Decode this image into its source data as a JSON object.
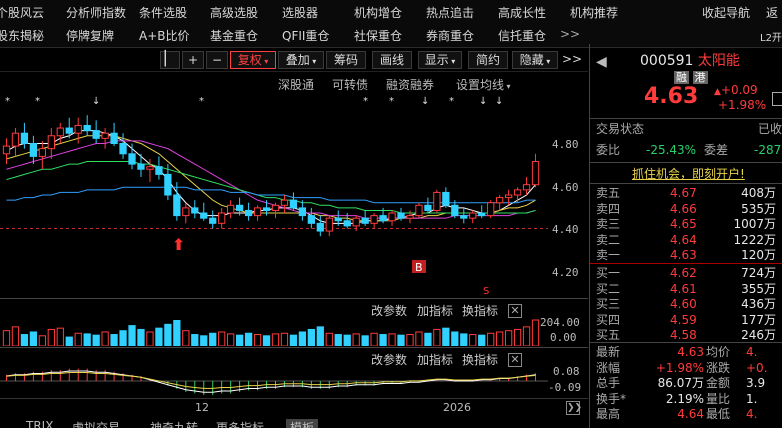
{
  "nav": {
    "row1": [
      "个股风云",
      "分析师指数",
      "条件选股",
      "高级选股",
      "选股器",
      "机构增仓",
      "热点追击",
      "高成长性",
      "机构推荐",
      "收起导航",
      "返"
    ],
    "row2": [
      "股东揭秘",
      "停牌复牌",
      "A+B比价",
      "基金重仓",
      "QFII重仓",
      "社保重仓",
      "券商重仓",
      "信托重仓",
      ">>"
    ],
    "right_tag": "L2开"
  },
  "toolbar": {
    "buttons": [
      "+",
      "−",
      "复权",
      "叠加",
      "筹码",
      "画线",
      "显示",
      "简约",
      "隐藏"
    ],
    "active": "复权",
    "more": ">>"
  },
  "chart_header": {
    "items": [
      "深股通",
      "可转债",
      "融资融券",
      "设置均线"
    ]
  },
  "price_axis": [
    "4.80",
    "4.60",
    "4.40",
    "4.20"
  ],
  "volume_panel": {
    "labels": [
      "改参数",
      "加指标",
      "换指标"
    ],
    "axis": [
      "204.00",
      "0.00"
    ]
  },
  "macd_panel": {
    "labels": [
      "改参数",
      "加指标",
      "换指标"
    ],
    "axis": [
      "0.08",
      "-0.09"
    ]
  },
  "x_axis": [
    "12",
    "2026"
  ],
  "markers": {
    "buy_label": "B",
    "sell_label": "S"
  },
  "bottom_tabs": [
    "TRIX",
    "虚拟交易",
    "神奇九转",
    "更多指标",
    "模板"
  ],
  "chart_data": {
    "type": "candlestick",
    "ylim": [
      4.1,
      4.9
    ],
    "reference_line": 4.37,
    "candles": [
      [
        4.66,
        4.72,
        4.62,
        4.69
      ],
      [
        4.69,
        4.76,
        4.65,
        4.74
      ],
      [
        4.74,
        4.78,
        4.68,
        4.7
      ],
      [
        4.7,
        4.73,
        4.62,
        4.65
      ],
      [
        4.65,
        4.71,
        4.6,
        4.68
      ],
      [
        4.68,
        4.76,
        4.64,
        4.73
      ],
      [
        4.73,
        4.78,
        4.7,
        4.76
      ],
      [
        4.76,
        4.8,
        4.72,
        4.74
      ],
      [
        4.74,
        4.8,
        4.7,
        4.77
      ],
      [
        4.77,
        4.81,
        4.73,
        4.75
      ],
      [
        4.75,
        4.79,
        4.7,
        4.72
      ],
      [
        4.72,
        4.76,
        4.68,
        4.74
      ],
      [
        4.74,
        4.78,
        4.69,
        4.7
      ],
      [
        4.7,
        4.74,
        4.64,
        4.66
      ],
      [
        4.66,
        4.7,
        4.6,
        4.62
      ],
      [
        4.62,
        4.66,
        4.57,
        4.6
      ],
      [
        4.6,
        4.64,
        4.55,
        4.61
      ],
      [
        4.61,
        4.65,
        4.56,
        4.58
      ],
      [
        4.58,
        4.62,
        4.48,
        4.5
      ],
      [
        4.5,
        4.55,
        4.4,
        4.42
      ],
      [
        4.42,
        4.47,
        4.39,
        4.45
      ],
      [
        4.45,
        4.48,
        4.41,
        4.43
      ],
      [
        4.43,
        4.47,
        4.4,
        4.41
      ],
      [
        4.41,
        4.44,
        4.37,
        4.39
      ],
      [
        4.39,
        4.45,
        4.37,
        4.43
      ],
      [
        4.43,
        4.48,
        4.41,
        4.46
      ],
      [
        4.46,
        4.49,
        4.42,
        4.44
      ],
      [
        4.44,
        4.47,
        4.4,
        4.42
      ],
      [
        4.42,
        4.46,
        4.4,
        4.45
      ],
      [
        4.45,
        4.48,
        4.42,
        4.44
      ],
      [
        4.44,
        4.47,
        4.41,
        4.46
      ],
      [
        4.46,
        4.5,
        4.43,
        4.48
      ],
      [
        4.48,
        4.51,
        4.44,
        4.45
      ],
      [
        4.45,
        4.48,
        4.4,
        4.42
      ],
      [
        4.42,
        4.45,
        4.37,
        4.39
      ],
      [
        4.39,
        4.42,
        4.34,
        4.36
      ],
      [
        4.36,
        4.42,
        4.34,
        4.41
      ],
      [
        4.41,
        4.44,
        4.38,
        4.4
      ],
      [
        4.4,
        4.43,
        4.37,
        4.38
      ],
      [
        4.38,
        4.42,
        4.36,
        4.41
      ],
      [
        4.41,
        4.44,
        4.38,
        4.39
      ],
      [
        4.39,
        4.43,
        4.37,
        4.42
      ],
      [
        4.42,
        4.45,
        4.39,
        4.4
      ],
      [
        4.4,
        4.44,
        4.38,
        4.43
      ],
      [
        4.43,
        4.45,
        4.4,
        4.41
      ],
      [
        4.41,
        4.44,
        4.39,
        4.42
      ],
      [
        4.42,
        4.47,
        4.41,
        4.46
      ],
      [
        4.46,
        4.49,
        4.43,
        4.44
      ],
      [
        4.44,
        4.52,
        4.43,
        4.51
      ],
      [
        4.51,
        4.53,
        4.45,
        4.46
      ],
      [
        4.46,
        4.48,
        4.41,
        4.42
      ],
      [
        4.42,
        4.45,
        4.39,
        4.41
      ],
      [
        4.41,
        4.44,
        4.39,
        4.43
      ],
      [
        4.43,
        4.46,
        4.41,
        4.42
      ],
      [
        4.42,
        4.48,
        4.41,
        4.47
      ],
      [
        4.47,
        4.5,
        4.44,
        4.49
      ],
      [
        4.49,
        4.52,
        4.46,
        4.5
      ],
      [
        4.5,
        4.53,
        4.47,
        4.52
      ],
      [
        4.52,
        4.57,
        4.5,
        4.54
      ],
      [
        4.54,
        4.66,
        4.53,
        4.63
      ]
    ],
    "ma": [
      {
        "name": "MA5",
        "color": "#ffffff",
        "values": [
          4.67,
          4.69,
          4.7,
          4.7,
          4.7,
          4.7,
          4.72,
          4.73,
          4.75,
          4.75,
          4.75,
          4.74,
          4.73,
          4.71,
          4.68,
          4.65,
          4.62,
          4.6,
          4.56,
          4.51,
          4.47,
          4.44,
          4.42,
          4.42,
          4.42,
          4.43,
          4.43,
          4.43,
          4.44,
          4.44,
          4.45,
          4.45,
          4.45,
          4.44,
          4.42,
          4.4,
          4.39,
          4.39,
          4.39,
          4.39,
          4.4,
          4.4,
          4.4,
          4.41,
          4.41,
          4.42,
          4.43,
          4.43,
          4.45,
          4.46,
          4.45,
          4.45,
          4.44,
          4.43,
          4.43,
          4.44,
          4.46,
          4.48,
          4.5,
          4.54
        ]
      },
      {
        "name": "MA10",
        "color": "#e8d34a",
        "values": [
          4.64,
          4.65,
          4.66,
          4.67,
          4.68,
          4.69,
          4.7,
          4.71,
          4.72,
          4.73,
          4.73,
          4.73,
          4.73,
          4.72,
          4.71,
          4.7,
          4.68,
          4.66,
          4.63,
          4.6,
          4.57,
          4.54,
          4.51,
          4.48,
          4.46,
          4.45,
          4.44,
          4.43,
          4.43,
          4.43,
          4.43,
          4.43,
          4.43,
          4.43,
          4.43,
          4.42,
          4.42,
          4.41,
          4.41,
          4.4,
          4.4,
          4.4,
          4.4,
          4.4,
          4.41,
          4.41,
          4.41,
          4.42,
          4.42,
          4.43,
          4.43,
          4.43,
          4.43,
          4.43,
          4.43,
          4.44,
          4.45,
          4.45,
          4.46,
          4.48
        ]
      },
      {
        "name": "MA20",
        "color": "#e040e0",
        "values": [
          4.6,
          4.61,
          4.62,
          4.63,
          4.64,
          4.65,
          4.66,
          4.67,
          4.68,
          4.69,
          4.7,
          4.7,
          4.71,
          4.71,
          4.71,
          4.71,
          4.7,
          4.69,
          4.68,
          4.66,
          4.64,
          4.62,
          4.6,
          4.58,
          4.56,
          4.54,
          4.52,
          4.5,
          4.48,
          4.47,
          4.46,
          4.45,
          4.44,
          4.43,
          4.43,
          4.43,
          4.42,
          4.42,
          4.42,
          4.42,
          4.41,
          4.41,
          4.41,
          4.41,
          4.41,
          4.41,
          4.41,
          4.41,
          4.41,
          4.41,
          4.42,
          4.42,
          4.42,
          4.42,
          4.42,
          4.42,
          4.42,
          4.43,
          4.43,
          4.44
        ]
      },
      {
        "name": "MA30",
        "color": "#30e060",
        "values": [
          4.56,
          4.57,
          4.58,
          4.59,
          4.6,
          4.6,
          4.61,
          4.62,
          4.62,
          4.63,
          4.63,
          4.63,
          4.63,
          4.63,
          4.63,
          4.62,
          4.62,
          4.61,
          4.6,
          4.59,
          4.58,
          4.57,
          4.56,
          4.55,
          4.54,
          4.53,
          4.52,
          4.51,
          4.5,
          4.49,
          4.49,
          4.48,
          4.48,
          4.47,
          4.47,
          4.46,
          4.46,
          4.45,
          4.45,
          4.45,
          4.44,
          4.44,
          4.44,
          4.44,
          4.43,
          4.43,
          4.43,
          4.43,
          4.43,
          4.43,
          4.43,
          4.43,
          4.43,
          4.43,
          4.43,
          4.43,
          4.43,
          4.43,
          4.43,
          4.44
        ]
      },
      {
        "name": "MA60",
        "color": "#30a0ff",
        "values": [
          4.48,
          4.48,
          4.49,
          4.49,
          4.5,
          4.5,
          4.51,
          4.51,
          4.51,
          4.52,
          4.52,
          4.52,
          4.52,
          4.53,
          4.53,
          4.53,
          4.53,
          4.53,
          4.53,
          4.53,
          4.53,
          4.52,
          4.52,
          4.52,
          4.52,
          4.51,
          4.51,
          4.51,
          4.5,
          4.5,
          4.5,
          4.5,
          4.49,
          4.49,
          4.49,
          4.49,
          4.48,
          4.48,
          4.48,
          4.48,
          4.48,
          4.47,
          4.47,
          4.47,
          4.47,
          4.47,
          4.47,
          4.47,
          4.47,
          4.47,
          4.47,
          4.47,
          4.47,
          4.47,
          4.47,
          4.47,
          4.47,
          4.47,
          4.48,
          4.48
        ]
      }
    ],
    "volume": [
      120,
      150,
      90,
      110,
      80,
      130,
      140,
      70,
      100,
      95,
      85,
      110,
      90,
      120,
      160,
      130,
      110,
      140,
      170,
      200,
      120,
      90,
      80,
      100,
      110,
      95,
      85,
      100,
      90,
      80,
      95,
      100,
      85,
      110,
      130,
      150,
      100,
      90,
      85,
      95,
      80,
      100,
      90,
      95,
      85,
      90,
      110,
      100,
      130,
      140,
      110,
      95,
      90,
      85,
      100,
      110,
      120,
      130,
      150,
      204
    ],
    "macd": [
      0.04,
      0.05,
      0.05,
      0.06,
      0.06,
      0.07,
      0.07,
      0.08,
      0.08,
      0.08,
      0.07,
      0.07,
      0.06,
      0.05,
      0.04,
      0.03,
      0.01,
      -0.01,
      -0.03,
      -0.05,
      -0.07,
      -0.08,
      -0.09,
      -0.09,
      -0.08,
      -0.08,
      -0.07,
      -0.06,
      -0.06,
      -0.05,
      -0.05,
      -0.04,
      -0.04,
      -0.04,
      -0.05,
      -0.05,
      -0.05,
      -0.04,
      -0.04,
      -0.03,
      -0.03,
      -0.03,
      -0.02,
      -0.02,
      -0.02,
      -0.01,
      -0.01,
      0.0,
      0.01,
      0.01,
      0.0,
      0.0,
      0.0,
      0.01,
      0.01,
      0.02,
      0.02,
      0.03,
      0.04,
      0.05
    ]
  },
  "quote": {
    "code": "000591",
    "name": "太阳能",
    "tags": [
      "融",
      "港"
    ],
    "price": "4.63",
    "change": "+0.09",
    "pct": "+1.98%",
    "status_label": "交易状态",
    "status_value": "已收",
    "weibi_label": "委比",
    "weibi_value": "-25.43%",
    "weicha_label": "委差",
    "weicha_value": "-287",
    "banner": "抓住机会，即刻开户!"
  },
  "orderbook": {
    "sells": [
      {
        "label": "卖五",
        "price": "4.67",
        "vol": "408万"
      },
      {
        "label": "卖四",
        "price": "4.66",
        "vol": "535万"
      },
      {
        "label": "卖三",
        "price": "4.65",
        "vol": "1007万"
      },
      {
        "label": "卖二",
        "price": "4.64",
        "vol": "1222万"
      },
      {
        "label": "卖一",
        "price": "4.63",
        "vol": "120万"
      }
    ],
    "buys": [
      {
        "label": "买一",
        "price": "4.62",
        "vol": "724万"
      },
      {
        "label": "买二",
        "price": "4.61",
        "vol": "355万"
      },
      {
        "label": "买三",
        "price": "4.60",
        "vol": "436万"
      },
      {
        "label": "买四",
        "price": "4.59",
        "vol": "177万"
      },
      {
        "label": "买五",
        "price": "4.58",
        "vol": "246万"
      }
    ]
  },
  "stats": [
    {
      "l1": "最新",
      "v1": "4.63",
      "l2": "均价",
      "v2": "4."
    },
    {
      "l1": "涨幅",
      "v1": "+1.98%",
      "l2": "涨跌",
      "v2": "+0."
    },
    {
      "l1": "总手",
      "v1": "86.07万",
      "l2": "金额",
      "v2": "3.9"
    },
    {
      "l1": "换手*",
      "v1": "2.19%",
      "l2": "量比",
      "v2": "1."
    },
    {
      "l1": "最高",
      "v1": "4.64",
      "l2": "最低",
      "v2": "4."
    }
  ]
}
